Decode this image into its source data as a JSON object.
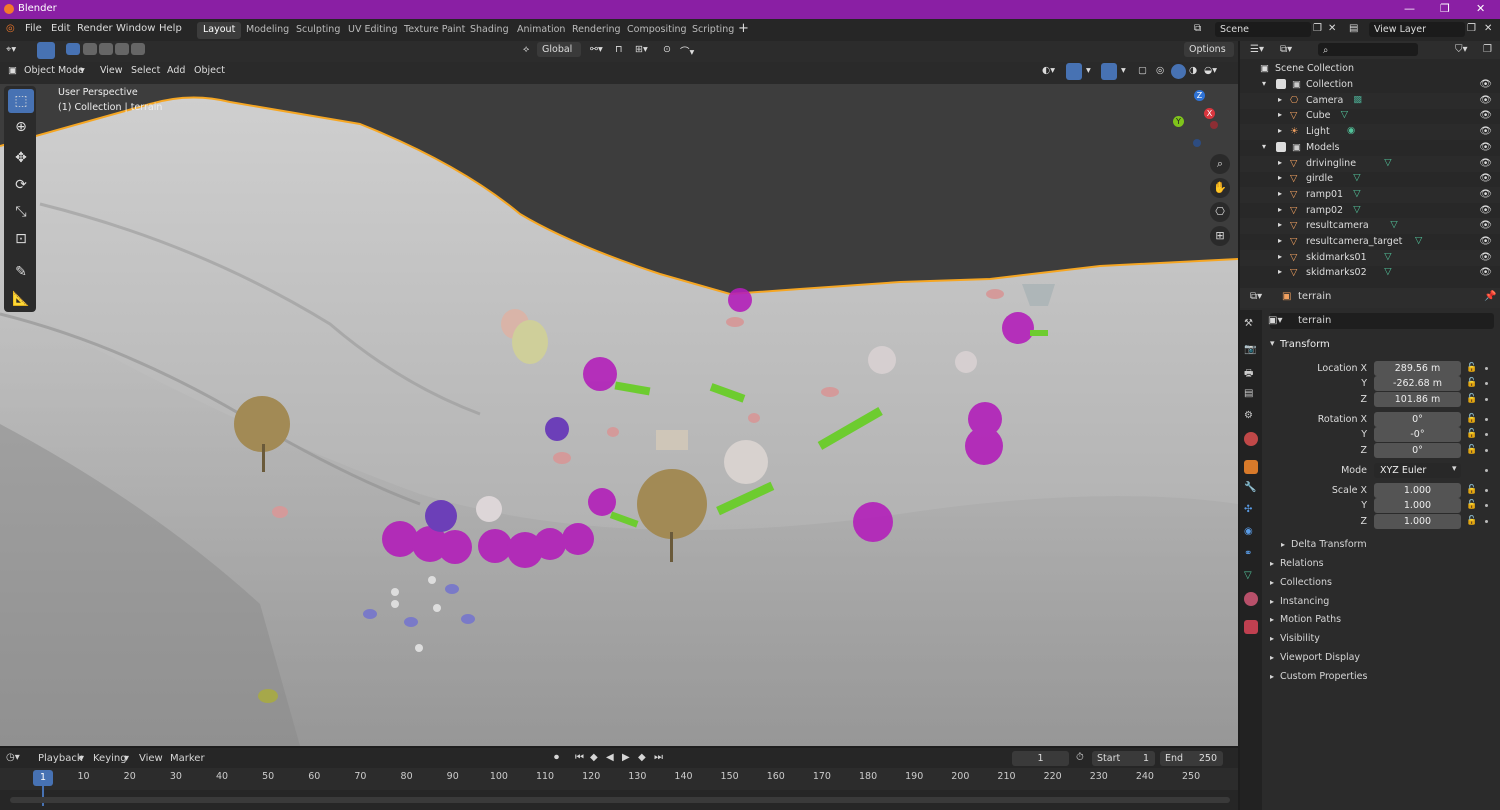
{
  "window": {
    "title": "Blender"
  },
  "menu": [
    "File",
    "Edit",
    "Render",
    "Window",
    "Help"
  ],
  "workspaces": [
    "Layout",
    "Modeling",
    "Sculpting",
    "UV Editing",
    "Texture Paint",
    "Shading",
    "Animation",
    "Rendering",
    "Compositing",
    "Scripting"
  ],
  "active_workspace": "Layout",
  "scene": {
    "scene_name": "Scene",
    "view_layer": "View Layer"
  },
  "viewport_header": {
    "mode": "Object Mode",
    "menus": [
      "View",
      "Select",
      "Add",
      "Object"
    ],
    "transform_orientation": "Global",
    "options": "Options"
  },
  "viewport": {
    "perspective": "User Perspective",
    "collection_info": "(1) Collection | terrain",
    "gizmo": {
      "x": "X",
      "y": "Y",
      "z": "Z"
    }
  },
  "outliner": {
    "root": "Scene Collection",
    "items": [
      {
        "name": "Collection",
        "level": 1
      },
      {
        "name": "Camera",
        "level": 2
      },
      {
        "name": "Cube",
        "level": 2
      },
      {
        "name": "Light",
        "level": 2
      },
      {
        "name": "Models",
        "level": 1
      },
      {
        "name": "drivingline",
        "level": 2
      },
      {
        "name": "girdle",
        "level": 2
      },
      {
        "name": "ramp01",
        "level": 2
      },
      {
        "name": "ramp02",
        "level": 2
      },
      {
        "name": "resultcamera",
        "level": 2
      },
      {
        "name": "resultcamera_target",
        "level": 2
      },
      {
        "name": "skidmarks01",
        "level": 2
      },
      {
        "name": "skidmarks02",
        "level": 2
      }
    ]
  },
  "properties": {
    "object_name": "terrain",
    "data_name": "terrain",
    "transform_title": "Transform",
    "location": {
      "label": "Location X",
      "x": "289.56 m",
      "y": "-262.68 m",
      "z": "101.86 m"
    },
    "rotation": {
      "label": "Rotation X",
      "x": "0°",
      "y": "-0°",
      "z": "0°"
    },
    "mode_label": "Mode",
    "mode_value": "XYZ Euler",
    "scale": {
      "label": "Scale X",
      "x": "1.000",
      "y": "1.000",
      "z": "1.000"
    },
    "axis_y": "Y",
    "axis_z": "Z",
    "delta": "Delta Transform",
    "sections": [
      "Relations",
      "Collections",
      "Instancing",
      "Motion Paths",
      "Visibility",
      "Viewport Display",
      "Custom Properties"
    ]
  },
  "timeline": {
    "menus": [
      "Playback",
      "Keying",
      "View",
      "Marker"
    ],
    "current_frame": "1",
    "start_label": "Start",
    "start": "1",
    "end_label": "End",
    "end": "250",
    "ticks": [
      "1",
      "10",
      "20",
      "30",
      "40",
      "50",
      "60",
      "70",
      "80",
      "90",
      "100",
      "110",
      "120",
      "130",
      "140",
      "150",
      "160",
      "170",
      "180",
      "190",
      "200",
      "210",
      "220",
      "230",
      "240",
      "250"
    ]
  },
  "colors": {
    "accent": "#4772b3",
    "titlebar": "#8a1fa4",
    "selection": "#f5a623",
    "bush": "#b21fb9",
    "ramp": "#6dcc2f"
  }
}
